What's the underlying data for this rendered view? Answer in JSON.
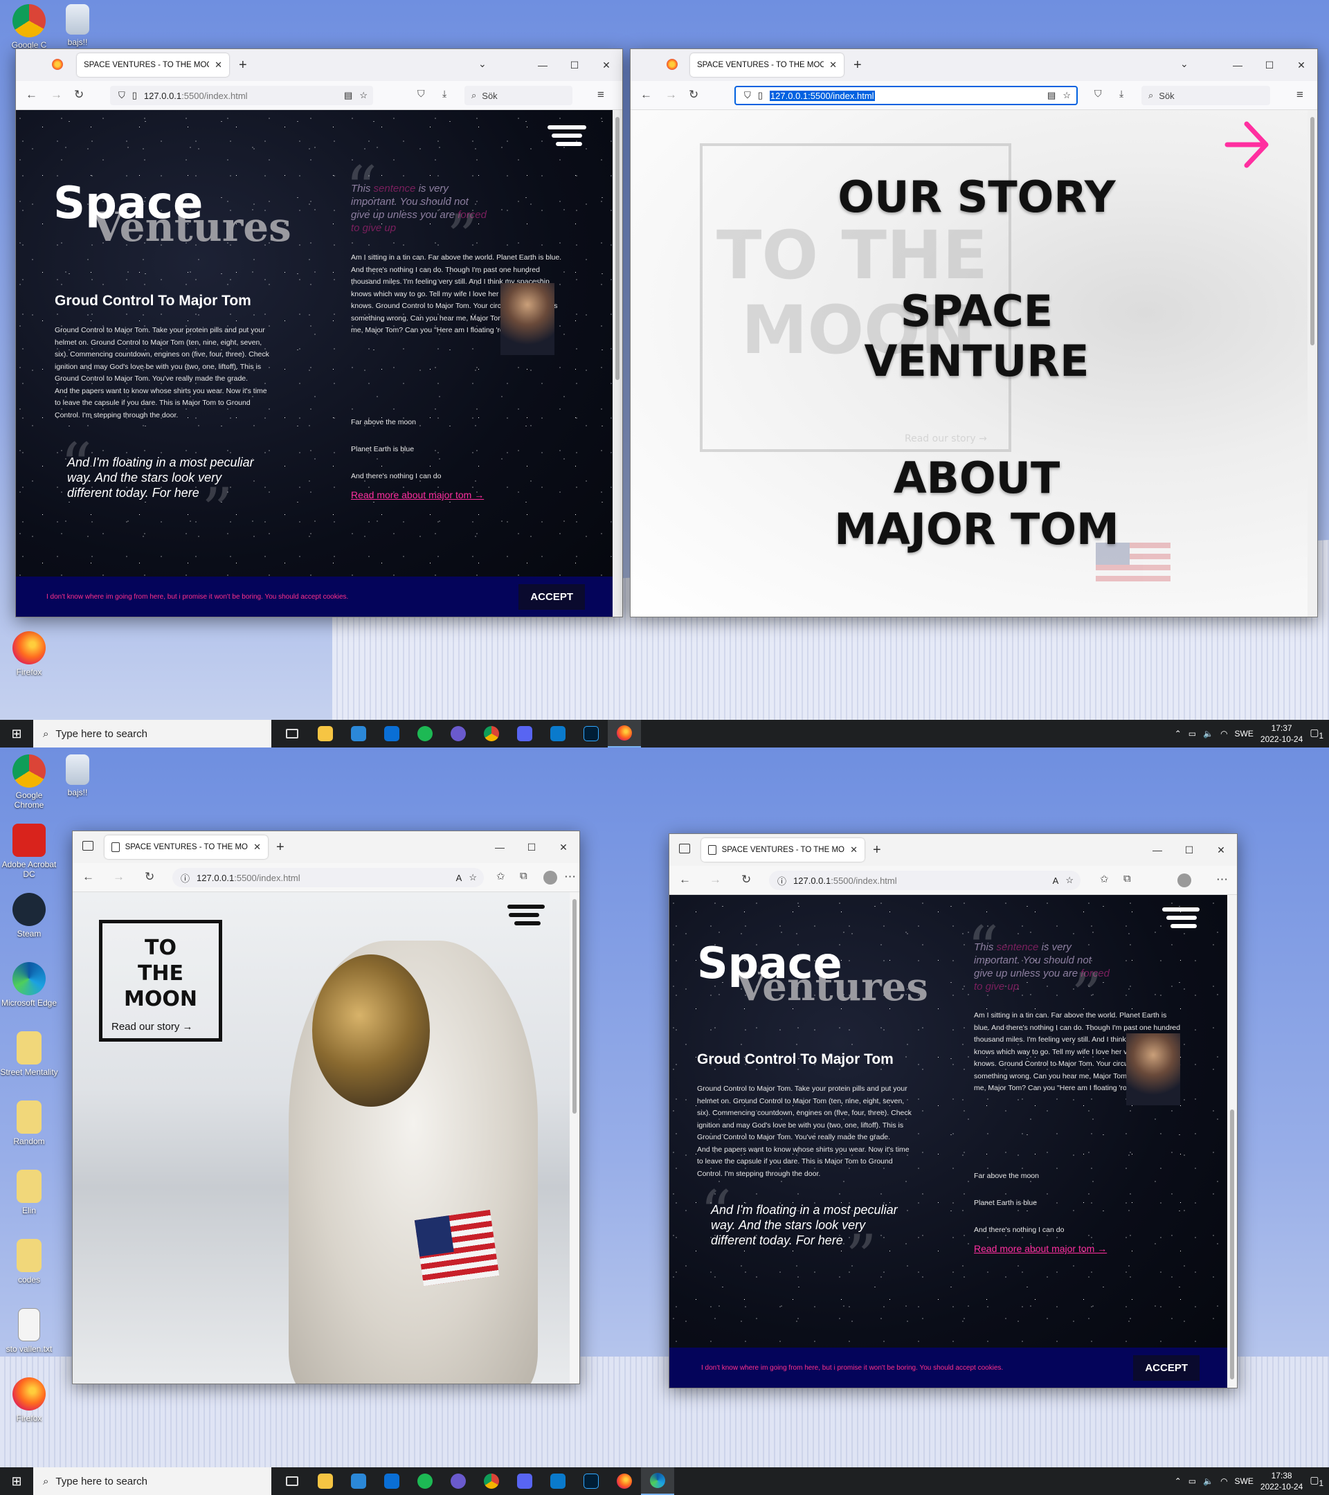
{
  "desktop": {
    "icons_top": [
      {
        "label": "Google C"
      },
      {
        "label": "bajs!!"
      },
      {
        "label": "Firefox"
      }
    ],
    "icons_bottom": [
      {
        "label": "Google Chrome"
      },
      {
        "label": "bajs!!"
      },
      {
        "label": "Adobe Acrobat DC"
      },
      {
        "label": "Steam"
      },
      {
        "label": "Microsoft Edge"
      },
      {
        "label": "Street Mentality"
      },
      {
        "label": "Random"
      },
      {
        "label": "Elin"
      },
      {
        "label": "codes"
      },
      {
        "label": "sto vallen.txt"
      },
      {
        "label": "Firefox"
      }
    ]
  },
  "taskbar": {
    "search_placeholder": "Type here to search",
    "lang": "SWE",
    "top_time": "17:37",
    "top_date": "2022-10-24",
    "bottom_time": "17:38",
    "bottom_date": "2022-10-24",
    "notif_count": "1"
  },
  "browser": {
    "tab_title": "SPACE VENTURES - TO THE MOON!",
    "tab_title_short": "SPACE VENTURES - TO THE MOC",
    "url_host": "127.0.0.1",
    "url_path": ":5500/index.html",
    "url_full": "127.0.0.1:5500/index.html",
    "search_label": "Sök"
  },
  "site": {
    "logo_space": "Space",
    "logo_ventures": "Ventures",
    "heading": "Groud Control To Major Tom",
    "body": "Ground Control to Major Tom. Take your protein pills and put your helmet on. Ground Control to Major Tom (ten, nine, eight, seven, six). Commencing countdown, engines on (five, four, three). Check ignition and may God's love be with you (two, one, liftoff). This is Ground Control to Major Tom. You've really made the grade.",
    "body2": "And the papers want to know whose shirts you wear. Now it's time to leave the capsule if you dare. This is Major Tom to Ground Control. I'm stepping through the door.",
    "quote": "And I'm floating in a most peculiar way. And the stars look very different today. For here",
    "small_quote_pre": "This ",
    "small_quote_hl1": "sentence",
    "small_quote_mid": " is very important. You should not give up unless you are ",
    "small_quote_hl2": "forced to give up",
    "col_text": "Am I sitting in a tin can. Far above the world. Planet Earth is blue. And there's nothing I can do. Though I'm past one hundred thousand miles. I'm feeling very still. And I think my spaceship knows which way to go. Tell my wife I love her very much she knows. Ground Control to Major Tom. Your circuit's dead, there's something wrong. Can you hear me, Major Tom? Can you hear me, Major Tom? Can you \"Here am I floating 'round my tin can.",
    "line1": "Far above the moon",
    "line2": "Planet Earth is blue",
    "line3": "And there's nothing I can do",
    "read_more": "Read more about major tom →",
    "cookie_text": "I don't know where im going from here, but i promise it won't be boring. You should accept cookies.",
    "accept": "ACCEPT"
  },
  "menu": {
    "item1": "OUR STORY",
    "item2_line1": "SPACE",
    "item2_line2": "VENTURE",
    "item3_line1": "ABOUT",
    "item3_line2": "MAJOR TOM",
    "ghost_line1": "TO THE",
    "ghost_line2": "MOON",
    "ghost_link": "Read our story →"
  },
  "home": {
    "box_line1": "TO",
    "box_line2": "THE",
    "box_line3": "MOON",
    "box_link": "Read our story →"
  },
  "colors": {
    "accent_pink": "#ff2fa0",
    "cookie_bg": "#04045a",
    "selection_blue": "#0061e0"
  }
}
